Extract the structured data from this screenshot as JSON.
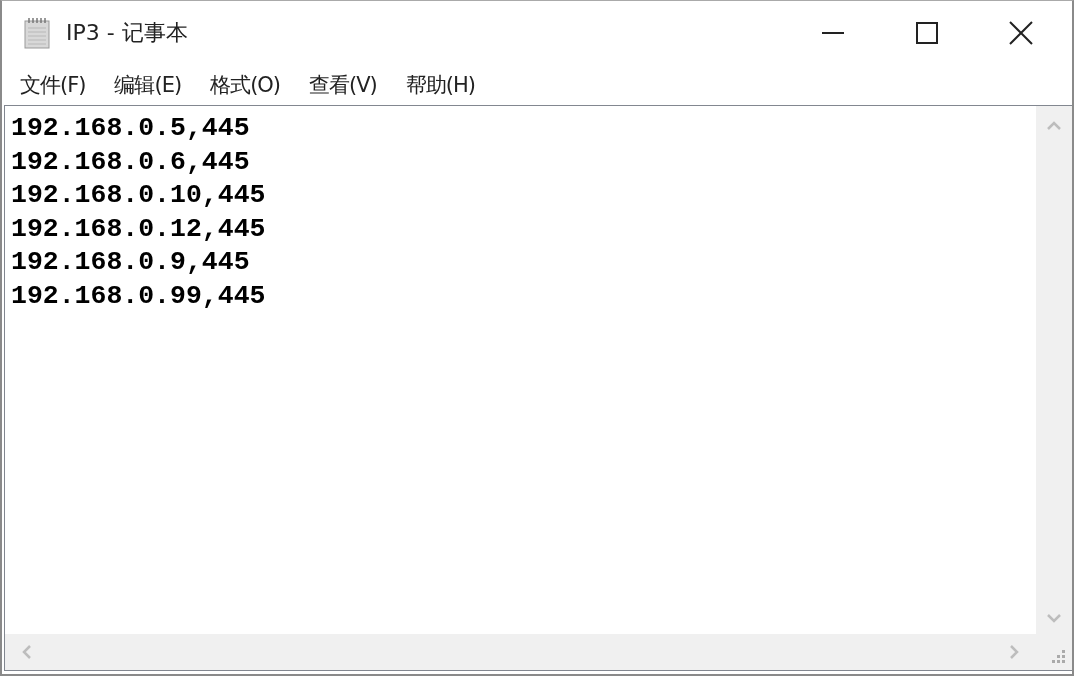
{
  "window": {
    "title": "IP3 - 记事本"
  },
  "menu": [
    "文件(F)",
    "编辑(E)",
    "格式(O)",
    "查看(V)",
    "帮助(H)"
  ],
  "editor": {
    "lines": [
      "192.168.0.5,445",
      "192.168.0.6,445",
      "192.168.0.10,445",
      "192.168.0.12,445",
      "192.168.0.9,445",
      "192.168.0.99,445"
    ]
  }
}
